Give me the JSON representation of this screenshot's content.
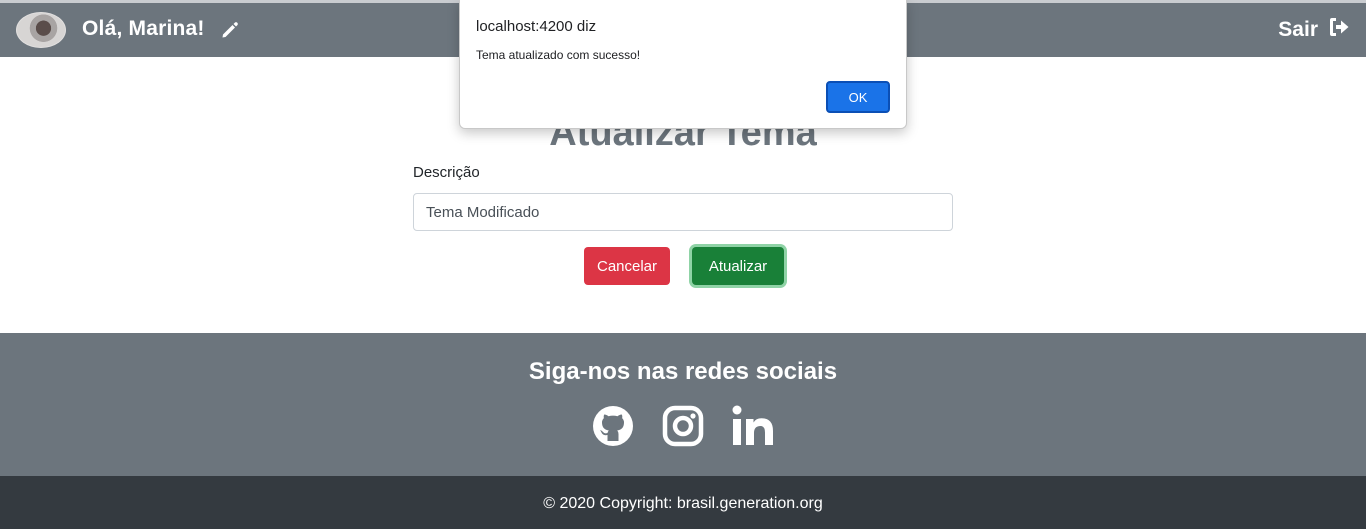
{
  "navbar": {
    "greeting": "Olá, Marina!",
    "logout_label": "Sair",
    "edit_icon": "pencil-icon",
    "logout_icon": "sign-out-icon"
  },
  "form": {
    "title": "Atualizar Tema",
    "description_label": "Descrição",
    "description_value": "Tema Modificado",
    "cancel_label": "Cancelar",
    "update_label": "Atualizar"
  },
  "footer": {
    "social_title": "Siga-nos nas redes sociais",
    "social_icons": [
      "github-icon",
      "instagram-icon",
      "linkedin-icon"
    ],
    "copyright": "© 2020 Copyright: brasil.generation.org"
  },
  "alert": {
    "origin": "localhost:4200 diz",
    "message": "Tema atualizado com sucesso!",
    "ok_label": "OK"
  },
  "colors": {
    "navbar": "#6c757d",
    "footer_dark": "#343a40",
    "danger": "#dc3545",
    "success": "#198038",
    "dialog_button": "#1a73e8"
  }
}
